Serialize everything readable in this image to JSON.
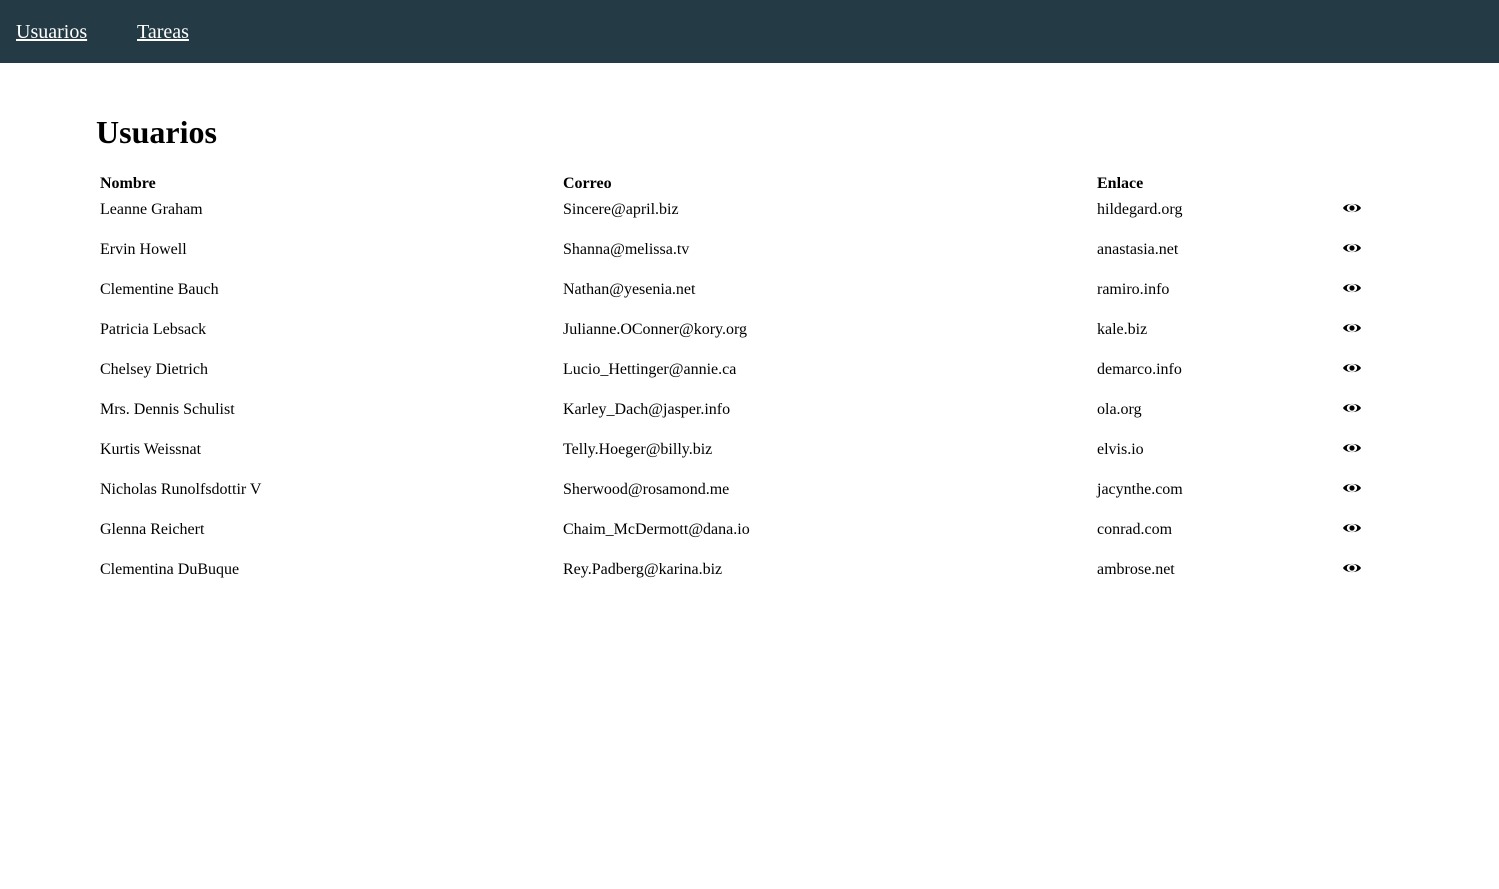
{
  "nav": {
    "users_label": "Usuarios",
    "tasks_label": "Tareas",
    "background": "#243a44"
  },
  "page": {
    "title": "Usuarios"
  },
  "table": {
    "headers": {
      "name": "Nombre",
      "email": "Correo",
      "link": "Enlace"
    },
    "action_icon": "eye-icon",
    "rows": [
      {
        "name": "Leanne Graham",
        "email": "Sincere@april.biz",
        "link": "hildegard.org"
      },
      {
        "name": "Ervin Howell",
        "email": "Shanna@melissa.tv",
        "link": "anastasia.net"
      },
      {
        "name": "Clementine Bauch",
        "email": "Nathan@yesenia.net",
        "link": "ramiro.info"
      },
      {
        "name": "Patricia Lebsack",
        "email": "Julianne.OConner@kory.org",
        "link": "kale.biz"
      },
      {
        "name": "Chelsey Dietrich",
        "email": "Lucio_Hettinger@annie.ca",
        "link": "demarco.info"
      },
      {
        "name": "Mrs. Dennis Schulist",
        "email": "Karley_Dach@jasper.info",
        "link": "ola.org"
      },
      {
        "name": "Kurtis Weissnat",
        "email": "Telly.Hoeger@billy.biz",
        "link": "elvis.io"
      },
      {
        "name": "Nicholas Runolfsdottir V",
        "email": "Sherwood@rosamond.me",
        "link": "jacynthe.com"
      },
      {
        "name": "Glenna Reichert",
        "email": "Chaim_McDermott@dana.io",
        "link": "conrad.com"
      },
      {
        "name": "Clementina DuBuque",
        "email": "Rey.Padberg@karina.biz",
        "link": "ambrose.net"
      }
    ]
  }
}
